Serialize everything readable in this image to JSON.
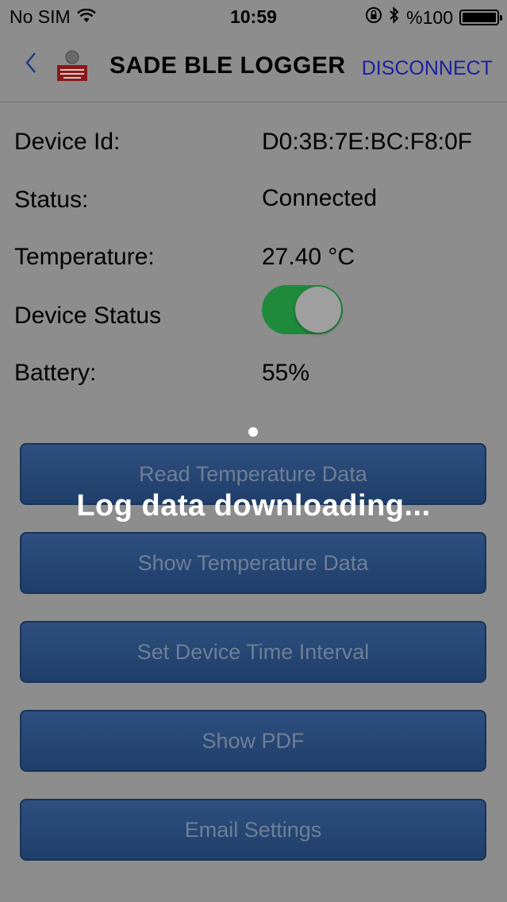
{
  "status_bar": {
    "carrier": "No SIM",
    "time": "10:59",
    "battery_percent": "%100"
  },
  "nav": {
    "title": "SADE BLE LOGGER",
    "disconnect_label": "DISCONNECT"
  },
  "info": {
    "device_id_label": "Device Id:",
    "device_id_value": "D0:3B:7E:BC:F8:0F",
    "status_label": "Status:",
    "status_value": "Connected",
    "temperature_label": "Temperature:",
    "temperature_value": "27.40 °C",
    "device_status_label": "Device Status",
    "battery_label": "Battery:",
    "battery_value": "55%"
  },
  "buttons": {
    "read_temperature": "Read Temperature Data",
    "show_temperature": "Show Temperature Data",
    "set_interval": "Set Device Time Interval",
    "show_pdf": "Show PDF",
    "email_settings": "Email Settings"
  },
  "overlay": {
    "message": "Log data downloading..."
  },
  "colors": {
    "accent": "#1d1fa3",
    "button": "#2a4a78",
    "toggle_on": "#1f8a3c"
  }
}
